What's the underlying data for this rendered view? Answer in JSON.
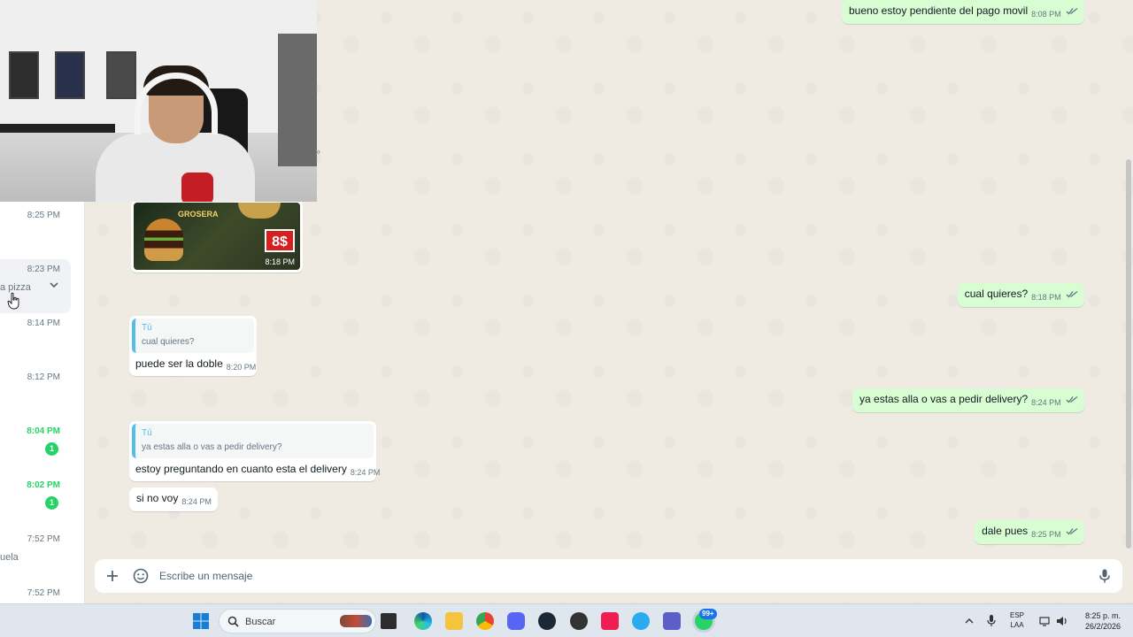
{
  "chat_list": {
    "rows": [
      {
        "time": "8:25 PM",
        "preview": "",
        "badge": ""
      },
      {
        "time": "8:23 PM",
        "preview": "a pizza",
        "badge": ""
      },
      {
        "time": "8:14 PM",
        "preview": "",
        "badge": ""
      },
      {
        "time": "8:12 PM",
        "preview": "",
        "badge": ""
      },
      {
        "time": "8:04 PM",
        "preview": "",
        "badge": "1"
      },
      {
        "time": "8:02 PM",
        "preview": "",
        "badge": "1"
      },
      {
        "time": "7:52 PM",
        "preview": "uela",
        "badge": ""
      },
      {
        "time": "7:52 PM",
        "preview": "",
        "badge": ""
      }
    ]
  },
  "image_message": {
    "title": "GROSERA",
    "price": "8$",
    "time": "8:18 PM"
  },
  "messages": [
    {
      "text": "bueno estoy pendiente del pago movil",
      "time": "8:08 PM",
      "direction": "out"
    },
    {
      "text": "cual quieres?",
      "time": "8:18 PM",
      "direction": "out"
    },
    {
      "quote_author": "Tú",
      "quote_text": "cual quieres?",
      "text": "puede ser la doble",
      "time": "8:20 PM",
      "direction": "in"
    },
    {
      "text": "ya estas alla o vas a pedir delivery?",
      "time": "8:24 PM",
      "direction": "out"
    },
    {
      "quote_author": "Tú",
      "quote_text": "ya estas alla o vas a pedir delivery?",
      "text": "estoy preguntando en cuanto esta el delivery",
      "time": "8:24 PM",
      "direction": "in"
    },
    {
      "text": "si no voy",
      "time": "8:24 PM",
      "direction": "in"
    },
    {
      "text": "dale pues",
      "time": "8:25 PM",
      "direction": "out"
    }
  ],
  "compose": {
    "placeholder": "Escribe un mensaje",
    "attach_icon": "plus-icon",
    "sticker_icon": "sticker-icon",
    "mic_icon": "microphone-icon"
  },
  "taskbar": {
    "search_placeholder": "Buscar",
    "lang_line1": "ESP",
    "lang_line2": "LAA",
    "clock_time": "8:25 p. m.",
    "clock_date": "26/2/2026",
    "whatsapp_badge": "99+"
  },
  "colors": {
    "outgoing_bubble": "#d9fdd3",
    "incoming_bubble": "#ffffff",
    "read_ticks": "#53bdeb",
    "unread_green": "#25d366",
    "chat_background": "#efeae2"
  }
}
